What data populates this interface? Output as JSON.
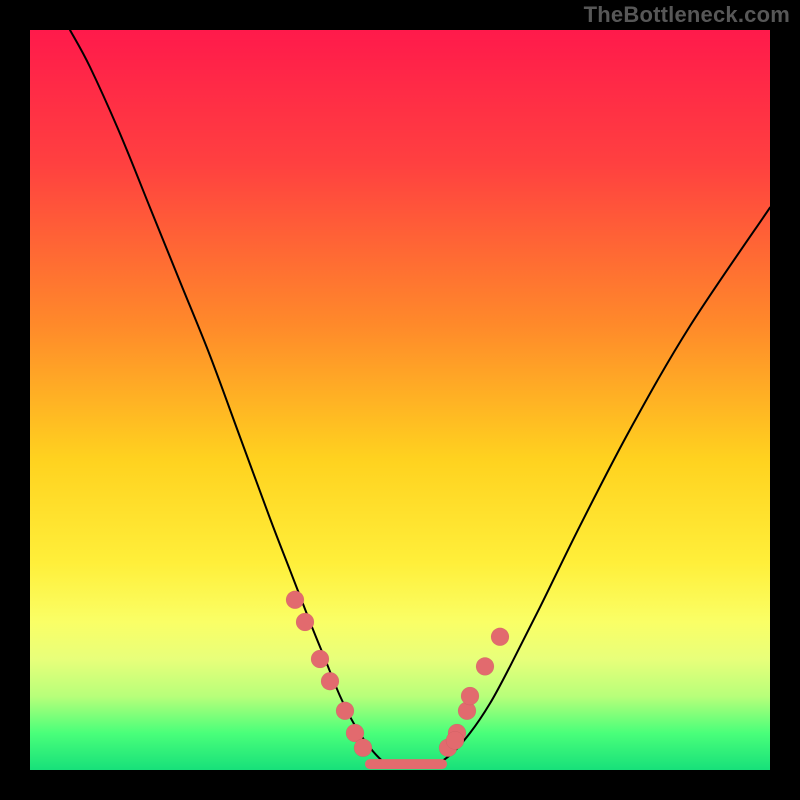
{
  "watermark": "TheBottleneck.com",
  "chart_data": {
    "type": "line",
    "title": "",
    "xlabel": "",
    "ylabel": "",
    "xlim": [
      0,
      740
    ],
    "ylim_percent": [
      0,
      100
    ],
    "note": "X in pixel units (0–740). Y as percent of plot height from top (0=top, 100=bottom). Curve is a V-shaped bottleneck curve overlaid on a red→yellow→green heat gradient.",
    "gradient_stops": [
      {
        "offset": 0,
        "color": "#ff1a4b"
      },
      {
        "offset": 18,
        "color": "#ff4040"
      },
      {
        "offset": 40,
        "color": "#ff8a2a"
      },
      {
        "offset": 58,
        "color": "#ffd21f"
      },
      {
        "offset": 72,
        "color": "#ffef3a"
      },
      {
        "offset": 80,
        "color": "#faff66"
      },
      {
        "offset": 85,
        "color": "#e8ff7a"
      },
      {
        "offset": 90,
        "color": "#b8ff7a"
      },
      {
        "offset": 95,
        "color": "#4aff7a"
      },
      {
        "offset": 100,
        "color": "#17e07a"
      }
    ],
    "series": [
      {
        "name": "bottleneck-curve",
        "x": [
          40,
          60,
          90,
          120,
          150,
          180,
          210,
          240,
          260,
          280,
          295,
          310,
          325,
          340,
          355,
          372,
          400,
          420,
          440,
          460,
          480,
          510,
          550,
          600,
          660,
          740
        ],
        "y_percent": [
          0,
          5,
          14,
          24,
          34,
          44,
          55,
          66,
          73,
          80,
          85,
          90,
          94,
          97,
          99,
          99.5,
          99.5,
          98,
          95,
          91,
          86,
          78,
          67,
          54,
          40,
          24
        ]
      }
    ],
    "markers": {
      "name": "dots",
      "x": [
        265,
        275,
        290,
        300,
        315,
        325,
        333,
        418,
        427,
        437,
        425,
        440,
        455,
        470
      ],
      "y_percent": [
        77,
        80,
        85,
        88,
        92,
        95,
        97,
        97,
        95,
        92,
        96,
        90,
        86,
        82
      ],
      "radius": 9
    },
    "flat_segment": {
      "x_start": 340,
      "x_end": 412,
      "y_percent": 99.2
    }
  }
}
